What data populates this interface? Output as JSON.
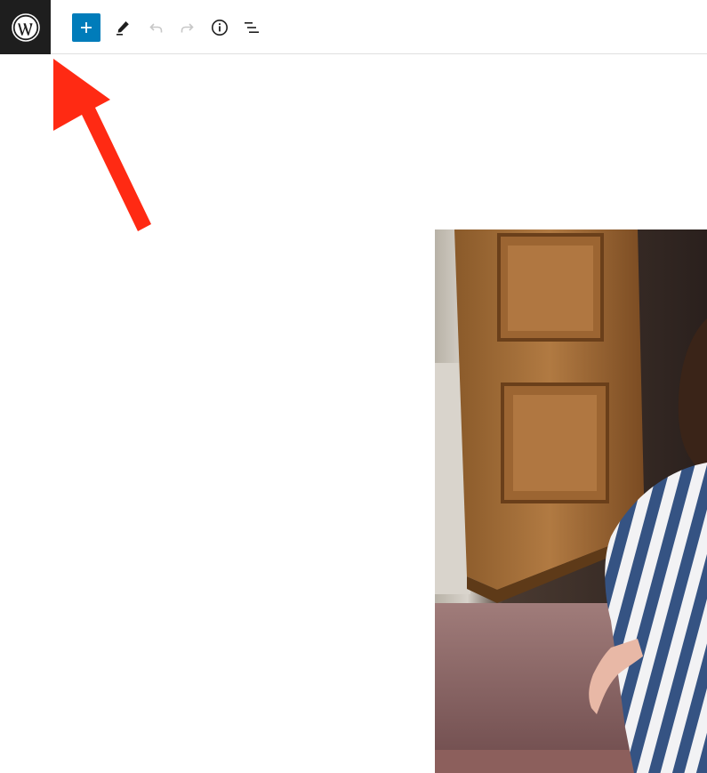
{
  "toolbar": {
    "logo_icon": "wordpress-logo-icon",
    "tools": [
      {
        "name": "add-block-button",
        "icon": "plus-icon",
        "accent": "#007cba"
      },
      {
        "name": "tools-button",
        "icon": "pencil-icon"
      },
      {
        "name": "undo-button",
        "icon": "undo-icon",
        "disabled": true
      },
      {
        "name": "redo-button",
        "icon": "redo-icon",
        "disabled": true
      },
      {
        "name": "details-button",
        "icon": "info-icon"
      },
      {
        "name": "list-view-button",
        "icon": "list-view-icon"
      }
    ]
  },
  "annotation": {
    "icon": "red-arrow-icon",
    "color": "#ff2a13"
  },
  "content": {
    "image": "photo-woman-striped-shirt-wooden-door"
  },
  "colors": {
    "logo_bg": "#1e1e1e",
    "accent": "#007cba",
    "arrow": "#ff2a13"
  }
}
